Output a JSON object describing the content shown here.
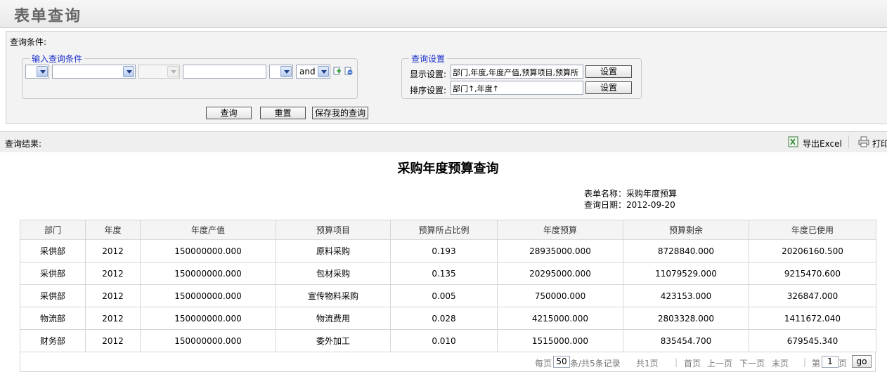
{
  "page_title": "表单查询",
  "query": {
    "section_label": "查询条件:",
    "input_legend": "输入查询条件",
    "logic_value": "and",
    "buttons": {
      "query": "查询",
      "reset": "重置",
      "save": "保存我的查询"
    },
    "settings_legend": "查询设置",
    "display_label": "显示设置:",
    "display_value": "部门,年度,年度产值,预算项目,预算所",
    "sort_label": "排序设置:",
    "sort_value": "部门↑,年度↑",
    "set_button": "设置"
  },
  "result": {
    "label": "查询结果:",
    "export_excel": "导出Excel",
    "print": "打印"
  },
  "report": {
    "title": "采购年度预算查询",
    "form_name_label": "表单名称：",
    "form_name": "采购年度预算",
    "query_date_label": "查询日期：",
    "query_date": "2012-09-20"
  },
  "table": {
    "columns": [
      "部门",
      "年度",
      "年度产值",
      "预算项目",
      "预算所占比例",
      "年度预算",
      "预算剩余",
      "年度已使用"
    ],
    "rows": [
      [
        "采供部",
        "2012",
        "150000000.000",
        "原料采购",
        "0.193",
        "28935000.000",
        "8728840.000",
        "20206160.500"
      ],
      [
        "采供部",
        "2012",
        "150000000.000",
        "包材采购",
        "0.135",
        "20295000.000",
        "11079529.000",
        "9215470.600"
      ],
      [
        "采供部",
        "2012",
        "150000000.000",
        "宣传物料采购",
        "0.005",
        "750000.000",
        "423153.000",
        "326847.000"
      ],
      [
        "物流部",
        "2012",
        "150000000.000",
        "物流费用",
        "0.028",
        "4215000.000",
        "2803328.000",
        "1411672.040"
      ],
      [
        "财务部",
        "2012",
        "150000000.000",
        "委外加工",
        "0.010",
        "1515000.000",
        "835454.700",
        "679545.340"
      ]
    ]
  },
  "pager": {
    "per_page_prefix": "每页",
    "per_page_value": "50",
    "per_page_suffix": "条/共5条记录",
    "total_pages": "共1页",
    "first": "首页",
    "prev": "上一页",
    "next": "下一页",
    "last": "末页",
    "goto_prefix": "第",
    "goto_value": "1",
    "goto_suffix": "页",
    "go": "go"
  },
  "colors": {
    "legend_blue": "#1a2fcc",
    "panel_bg": "#f3f3f3",
    "header_bg": "#efefef"
  }
}
